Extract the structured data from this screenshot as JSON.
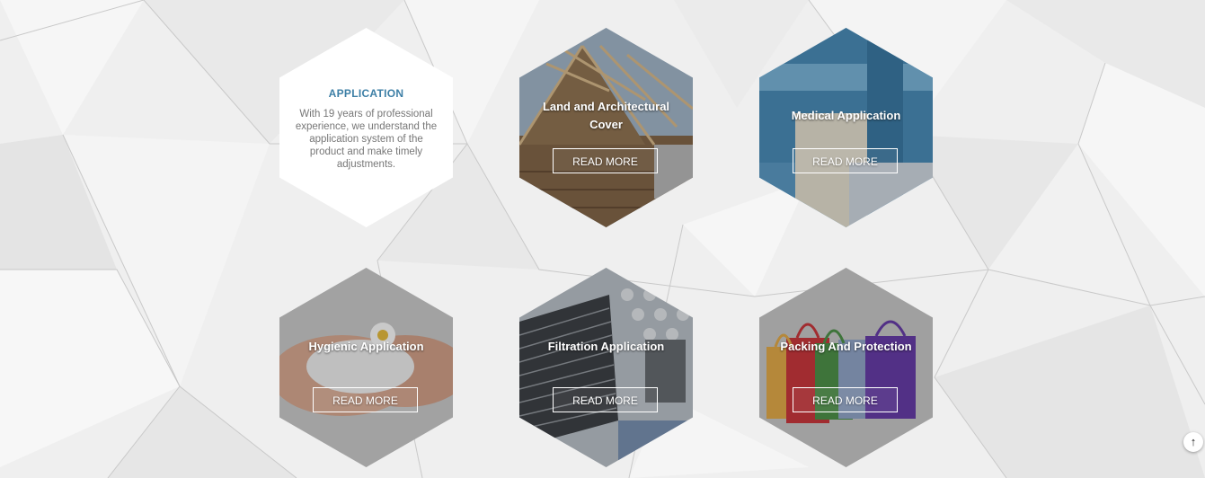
{
  "intro": {
    "heading": "APPLICATION",
    "description": "With 19 years of professional experience, we understand the application system of the product and make timely adjustments."
  },
  "cards": [
    {
      "title": "Land and Architectural Cover",
      "button": "READ MORE",
      "image": "roof-timber-construction"
    },
    {
      "title": "Medical Application",
      "button": "READ MORE",
      "image": "blue-medical-nonwoven"
    },
    {
      "title": "Hygienic Application",
      "button": "READ MORE",
      "image": "hands-holding-pad-with-daisy"
    },
    {
      "title": "Filtration Application",
      "button": "READ MORE",
      "image": "pleated-filter-perforated-plate"
    },
    {
      "title": "Packing And Protection",
      "button": "READ MORE",
      "image": "colorful-nonwoven-bags"
    }
  ],
  "scroll_top": {
    "icon": "arrow-up-icon",
    "glyph": "↑"
  }
}
